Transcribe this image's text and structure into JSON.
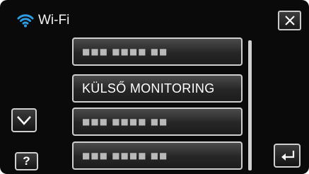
{
  "header": {
    "title": "Wi-Fi",
    "icon": "wifi-icon",
    "accent_color": "#2f9be0"
  },
  "close_button": {
    "icon": "close-icon"
  },
  "list": {
    "items": [
      {
        "label": "■■■ ■■■■ ■■",
        "masked": true
      },
      {
        "label": "KÜLSŐ MONITORING",
        "masked": false
      },
      {
        "label": "■■■ ■■■■ ■■",
        "masked": true
      },
      {
        "label": "■■■ ■■■■ ■■",
        "masked": true
      }
    ]
  },
  "controls": {
    "scroll_down_icon": "chevron-down-icon",
    "help_label": "?",
    "back_icon": "return-arrow-icon"
  }
}
